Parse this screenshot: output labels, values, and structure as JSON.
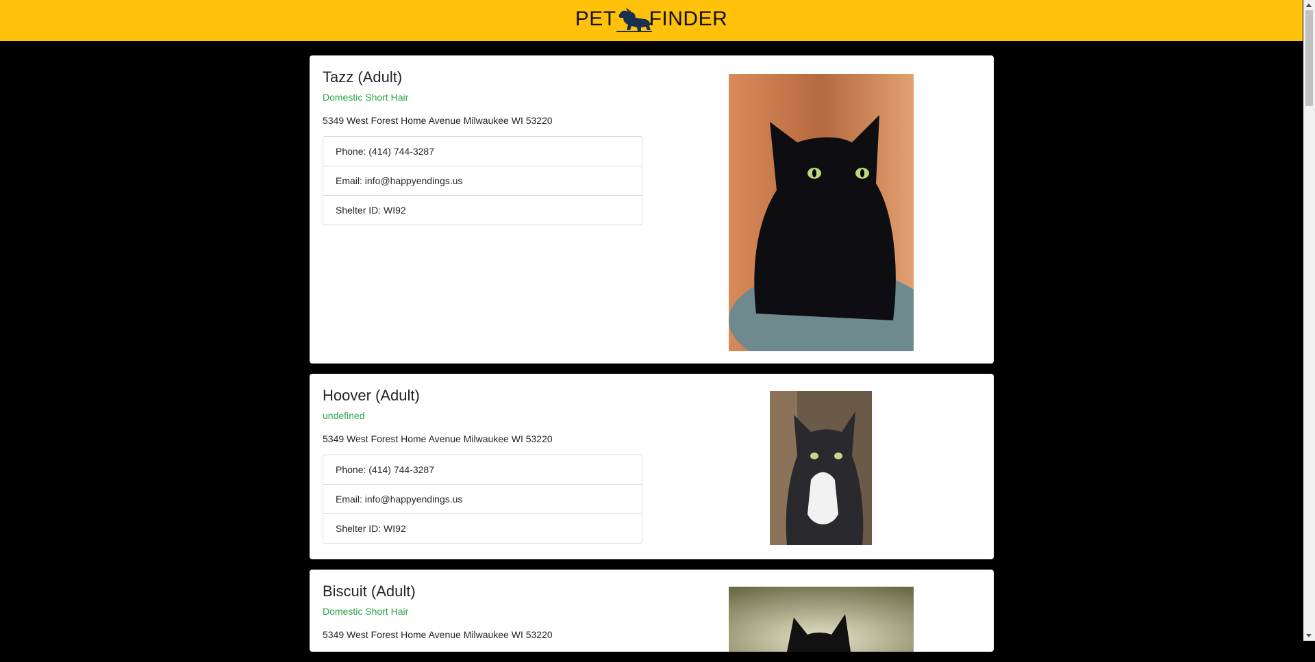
{
  "header": {
    "logo_left": "PET",
    "logo_right": "FINDER",
    "background": "#FFC10A"
  },
  "pets": [
    {
      "name": "Tazz (Adult)",
      "breed": "Domestic Short Hair",
      "address": "5349 West Forest Home Avenue Milwaukee WI 53220",
      "phone": "Phone: (414) 744-3287",
      "email": "Email: info@happyendings.us",
      "shelter": "Shelter ID: WI92",
      "photo_alt": "Tazz"
    },
    {
      "name": "Hoover (Adult)",
      "breed": "undefined",
      "address": "5349 West Forest Home Avenue Milwaukee WI 53220",
      "phone": "Phone: (414) 744-3287",
      "email": "Email: info@happyendings.us",
      "shelter": "Shelter ID: WI92",
      "photo_alt": "Hoover"
    },
    {
      "name": "Biscuit (Adult)",
      "breed": "Domestic Short Hair",
      "address": "5349 West Forest Home Avenue Milwaukee WI 53220",
      "photo_alt": "Biscuit"
    }
  ],
  "colors": {
    "accent_green": "#28a745",
    "page_bg": "#000000"
  }
}
